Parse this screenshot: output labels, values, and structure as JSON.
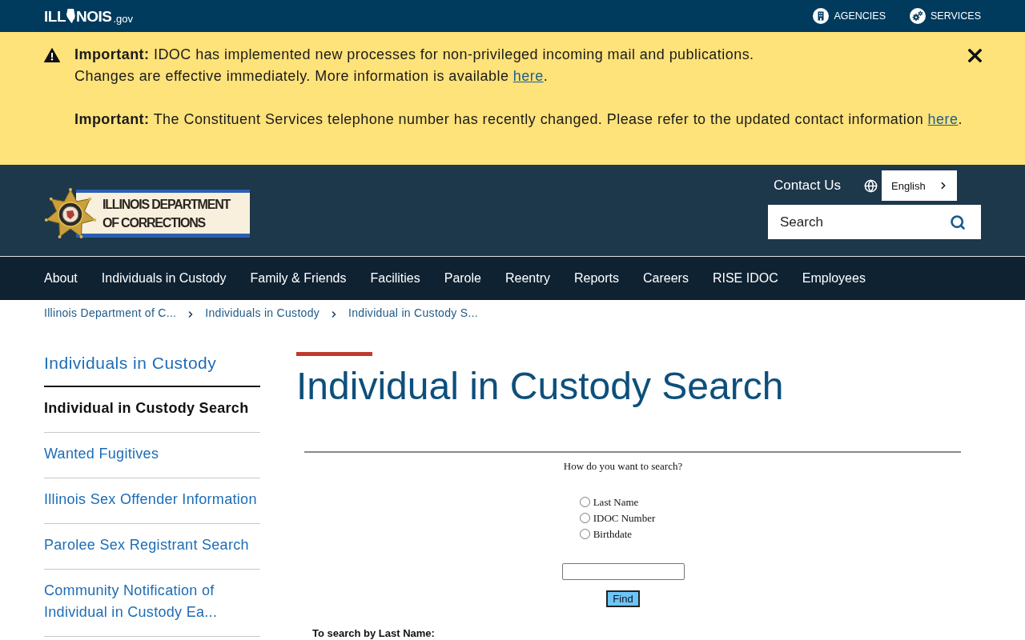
{
  "top_bar": {
    "logo": {
      "before": "ILL",
      "after": "NOIS",
      "domain": ".gov"
    },
    "links": [
      {
        "label": "AGENCIES",
        "kind": "agencies"
      },
      {
        "label": "SERVICES",
        "kind": "services"
      }
    ]
  },
  "alert": {
    "messages": [
      {
        "lines": [
          "**Important:** IDOC has implemented new processes for non-privileged incoming mail and publications.",
          "Changes are effective immediately. More information is available"
        ],
        "link": "here",
        "after": "."
      },
      {
        "lines": [
          "**Important:** The Constituent Services telephone number has recently changed. Please refer to the updated contact information"
        ],
        "link": "here",
        "after": "."
      }
    ]
  },
  "header": {
    "logo_lines": [
      "ILLINOIS DEPARTMENT",
      "OF CORRECTIONS"
    ],
    "contact_link": "Contact Us",
    "language": "English",
    "search": {
      "placeholder": "Search"
    }
  },
  "nav": [
    "About",
    "Individuals in Custody",
    "Family & Friends",
    "Facilities",
    "Parole",
    "Reentry",
    "Reports",
    "Careers",
    "RISE IDOC",
    "Employees"
  ],
  "breadcrumbs": [
    "Illinois Department of C...",
    "Individuals in Custody",
    "Individual in Custody S..."
  ],
  "sidebar": {
    "title": "Individuals in Custody",
    "items": [
      {
        "label": "Individual in Custody Search",
        "selected": true
      },
      {
        "label": "Wanted Fugitives",
        "selected": false
      },
      {
        "label": "Illinois Sex Offender Information",
        "selected": false
      },
      {
        "label": "Parolee Sex Registrant Search",
        "selected": false
      },
      {
        "label": "Community Notification of Individual in Custody Ea...",
        "selected": false
      }
    ]
  },
  "page": {
    "title": "Individual in Custody Search",
    "form": {
      "prompt": "How do you want to search?",
      "options": [
        {
          "label": "Last Name",
          "selected": false
        },
        {
          "label": "IDOC Number",
          "selected": false
        },
        {
          "label": "Birthdate",
          "selected": false
        }
      ],
      "button": "Find"
    },
    "section_heading": "To search by Last Name:"
  }
}
